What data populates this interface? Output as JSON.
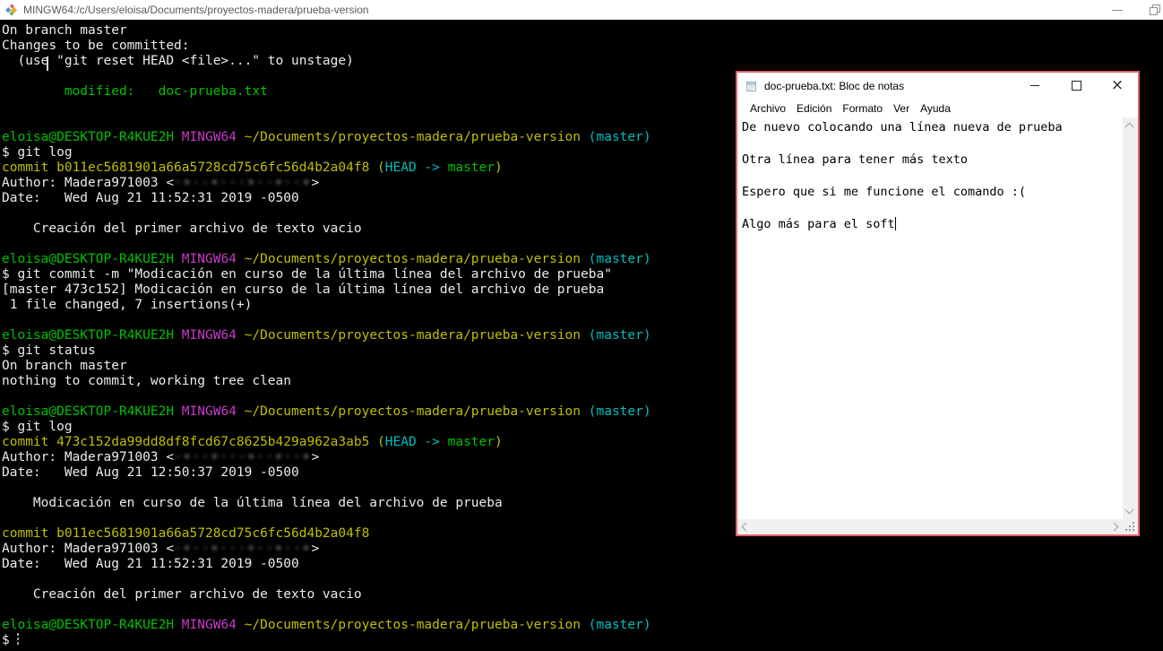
{
  "colors": {
    "term_bg": "#000000",
    "term_fg": "#ebebeb",
    "term_green": "#00c200",
    "term_magenta": "#c53bc7",
    "term_yellow": "#bfbf00",
    "term_cyan": "#00bfbf",
    "titlebar_bg": "#ffffff",
    "titlebar_fg": "#5a5a5a",
    "np_border": "#e4606c",
    "scrollbar_bg": "#f0f0f0",
    "scroll_arrow": "#a0a0a0"
  },
  "terminal": {
    "title": "MINGW64:/c/Users/eloisa/Documents/proyectos-madera/prueba-version",
    "app_icon": "git-mingw64-icon",
    "window_buttons": [
      "minimize",
      "restore"
    ],
    "prompt_user": "eloisa@DESKTOP-R4KUE2H",
    "prompt_system": "MINGW64",
    "prompt_path": "~/Documents/proyectos-madera/prueba-version",
    "prompt_branch": "(master)",
    "lines": [
      [
        {
          "c": "fg",
          "t": "On branch master"
        }
      ],
      [
        {
          "c": "fg",
          "t": "Changes to be committed:"
        }
      ],
      [
        {
          "c": "fg",
          "t": "  (use \"git reset HEAD <file>...\" to unstage)"
        }
      ],
      [],
      [
        {
          "c": "green",
          "t": "        modified:   doc-prueba.txt"
        }
      ],
      [],
      [],
      [
        {
          "c": "green",
          "t": "eloisa@DESKTOP-R4KUE2H "
        },
        {
          "c": "magenta",
          "t": "MINGW64 "
        },
        {
          "c": "yellow",
          "t": "~/Documents/proyectos-madera/prueba-version "
        },
        {
          "c": "cyan",
          "t": "(master)"
        }
      ],
      [
        {
          "c": "fg",
          "t": "$ git log"
        }
      ],
      [
        {
          "c": "yellow",
          "t": "commit b011ec5681901a66a5728cd75c6fc56d4b2a04f8 ("
        },
        {
          "c": "cyan",
          "t": "HEAD -> "
        },
        {
          "c": "green",
          "t": "master"
        },
        {
          "c": "yellow",
          "t": ")"
        }
      ],
      [
        {
          "c": "fg",
          "t": "Author: Madera971003 <"
        },
        {
          "c": "smudge",
          "t": "·•··•···•··•··•"
        },
        {
          "c": "fg",
          "t": ">"
        }
      ],
      [
        {
          "c": "fg",
          "t": "Date:   Wed Aug 21 11:52:31 2019 -0500"
        }
      ],
      [],
      [
        {
          "c": "fg",
          "t": "    Creación del primer archivo de texto vacio"
        }
      ],
      [],
      [
        {
          "c": "green",
          "t": "eloisa@DESKTOP-R4KUE2H "
        },
        {
          "c": "magenta",
          "t": "MINGW64 "
        },
        {
          "c": "yellow",
          "t": "~/Documents/proyectos-madera/prueba-version "
        },
        {
          "c": "cyan",
          "t": "(master)"
        }
      ],
      [
        {
          "c": "fg",
          "t": "$ git commit -m \"Modicación en curso de la última línea del archivo de prueba\""
        }
      ],
      [
        {
          "c": "fg",
          "t": "[master 473c152] Modicación en curso de la última línea del archivo de prueba"
        }
      ],
      [
        {
          "c": "fg",
          "t": " 1 file changed, 7 insertions(+)"
        }
      ],
      [],
      [
        {
          "c": "green",
          "t": "eloisa@DESKTOP-R4KUE2H "
        },
        {
          "c": "magenta",
          "t": "MINGW64 "
        },
        {
          "c": "yellow",
          "t": "~/Documents/proyectos-madera/prueba-version "
        },
        {
          "c": "cyan",
          "t": "(master)"
        }
      ],
      [
        {
          "c": "fg",
          "t": "$ git status"
        }
      ],
      [
        {
          "c": "fg",
          "t": "On branch master"
        }
      ],
      [
        {
          "c": "fg",
          "t": "nothing to commit, working tree clean"
        }
      ],
      [],
      [
        {
          "c": "green",
          "t": "eloisa@DESKTOP-R4KUE2H "
        },
        {
          "c": "magenta",
          "t": "MINGW64 "
        },
        {
          "c": "yellow",
          "t": "~/Documents/proyectos-madera/prueba-version "
        },
        {
          "c": "cyan",
          "t": "(master)"
        }
      ],
      [
        {
          "c": "fg",
          "t": "$ git log"
        }
      ],
      [
        {
          "c": "yellow",
          "t": "commit 473c152da99dd8df8fcd67c8625b429a962a3ab5 ("
        },
        {
          "c": "cyan",
          "t": "HEAD -> "
        },
        {
          "c": "green",
          "t": "master"
        },
        {
          "c": "yellow",
          "t": ")"
        }
      ],
      [
        {
          "c": "fg",
          "t": "Author: Madera971003 <"
        },
        {
          "c": "smudge",
          "t": "·•··•···•··•··•"
        },
        {
          "c": "fg",
          "t": ">"
        }
      ],
      [
        {
          "c": "fg",
          "t": "Date:   Wed Aug 21 12:50:37 2019 -0500"
        }
      ],
      [],
      [
        {
          "c": "fg",
          "t": "    Modicación en curso de la última línea del archivo de prueba"
        }
      ],
      [],
      [
        {
          "c": "yellow",
          "t": "commit b011ec5681901a66a5728cd75c6fc56d4b2a04f8"
        }
      ],
      [
        {
          "c": "fg",
          "t": "Author: Madera971003 <"
        },
        {
          "c": "smudge",
          "t": "·•··•···•··•··•"
        },
        {
          "c": "fg",
          "t": ">"
        }
      ],
      [
        {
          "c": "fg",
          "t": "Date:   Wed Aug 21 11:52:31 2019 -0500"
        }
      ],
      [],
      [
        {
          "c": "fg",
          "t": "    Creación del primer archivo de texto vacio"
        }
      ],
      [],
      [
        {
          "c": "green",
          "t": "eloisa@DESKTOP-R4KUE2H "
        },
        {
          "c": "magenta",
          "t": "MINGW64 "
        },
        {
          "c": "yellow",
          "t": "~/Documents/proyectos-madera/prueba-version "
        },
        {
          "c": "cyan",
          "t": "(master)"
        }
      ],
      [
        {
          "c": "fg",
          "t": "$ "
        },
        {
          "c": "cursor",
          "t": ""
        }
      ]
    ]
  },
  "notepad": {
    "title": "doc-prueba.txt: Bloc de notas",
    "app_icon": "notepad-icon",
    "window_buttons": [
      "minimize",
      "maximize",
      "close"
    ],
    "menu": [
      {
        "name": "archivo",
        "label": "Archivo"
      },
      {
        "name": "edicion",
        "label": "Edición"
      },
      {
        "name": "formato",
        "label": "Formato"
      },
      {
        "name": "ver",
        "label": "Ver"
      },
      {
        "name": "ayuda",
        "label": "Ayuda"
      }
    ],
    "lines": [
      "De nuevo colocando una línea nueva de prueba",
      "",
      "Otra línea para tener más texto",
      "",
      "Espero que si me funcione el comando :(",
      "",
      "Algo más para el soft"
    ],
    "caret_line": 6
  }
}
